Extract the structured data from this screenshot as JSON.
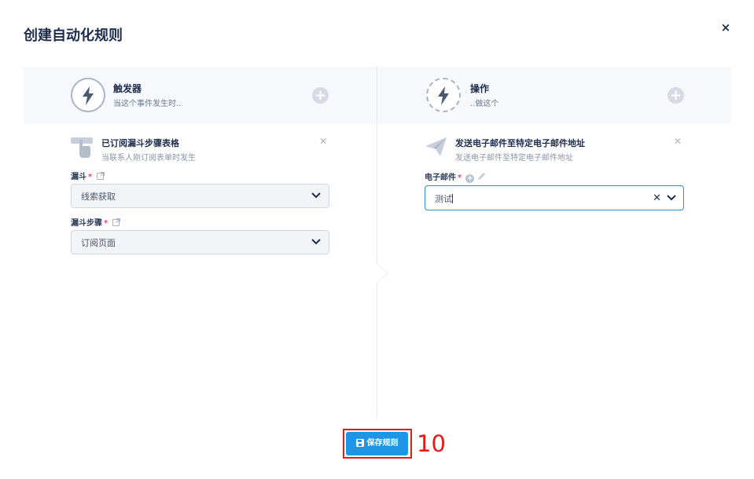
{
  "modal": {
    "title": "创建自动化规则",
    "close_label": "×"
  },
  "trigger": {
    "title": "触发器",
    "subtitle": "当这个事件发生时..",
    "item_title": "已订阅漏斗步骤表格",
    "item_subtitle": "当联系人刚订阅表单时发生",
    "funnel_label": "漏斗",
    "funnel_value": "线索获取",
    "step_label": "漏斗步骤",
    "step_value": "订阅页面"
  },
  "action": {
    "title": "操作",
    "subtitle": "..做这个",
    "item_title": "发送电子邮件至特定电子邮件地址",
    "item_subtitle": "发送电子邮件至特定电子邮件地址",
    "email_label": "电子邮件",
    "email_value": "测试"
  },
  "footer": {
    "save_label": "保存规则"
  },
  "annotation": {
    "step_number": "10"
  },
  "icons": {
    "close": "close-icon",
    "trigger": "lightning-icon",
    "action": "lightning-cycle-icon",
    "add": "plus-icon",
    "tap": "tap-hand-icon",
    "send": "paper-plane-icon",
    "external": "external-link-icon",
    "chevron": "chevron-down-icon",
    "pencil": "pencil-icon",
    "save": "floppy-disk-icon"
  },
  "colors": {
    "primary": "#1f95e6",
    "required": "#e0506a",
    "focus_border": "#2a8fd8",
    "annotation": "#e41a1a"
  }
}
